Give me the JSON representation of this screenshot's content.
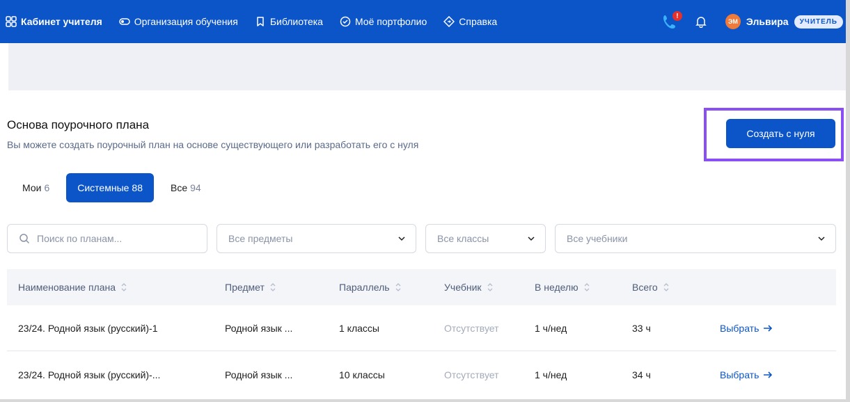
{
  "topbar": {
    "brand": "Кабинет учителя",
    "nav": [
      {
        "label": "Организация обучения",
        "icon": "toggle-icon"
      },
      {
        "label": "Библиотека",
        "icon": "bookmark-icon"
      },
      {
        "label": "Моё портфолио",
        "icon": "check-circle-icon"
      },
      {
        "label": "Справка",
        "icon": "diamond-arrow-icon"
      }
    ],
    "phone_badge": "!",
    "avatar_initials": "ЭМ",
    "username": "Эльвира",
    "role": "УЧИТЕЛЬ"
  },
  "header": {
    "title": "Основа поурочного плана",
    "subtitle": "Вы можете создать поурочный план на основе существующего или разработать его с нуля",
    "create_label": "Создать с нуля"
  },
  "tabs": [
    {
      "label": "Мои",
      "count": "6",
      "active": false
    },
    {
      "label": "Системные",
      "count": "88",
      "active": true
    },
    {
      "label": "Все",
      "count": "94",
      "active": false
    }
  ],
  "filters": {
    "search_placeholder": "Поиск по планам...",
    "subject": "Все предметы",
    "grade": "Все классы",
    "textbook": "Все учебники"
  },
  "table": {
    "columns": [
      "Наименование плана",
      "Предмет",
      "Параллель",
      "Учебник",
      "В неделю",
      "Всего"
    ],
    "rows": [
      {
        "name": "23/24. Родной язык (русский)-1",
        "subject": "Родной язык ...",
        "grade": "1 классы",
        "textbook": "Отсутствует",
        "per_week": "1 ч/нед",
        "total": "33 ч",
        "action": "Выбрать"
      },
      {
        "name": "23/24. Родной язык (русский)-...",
        "subject": "Родной язык ...",
        "grade": "10 классы",
        "textbook": "Отсутствует",
        "per_week": "1 ч/нед",
        "total": "34 ч",
        "action": "Выбрать"
      }
    ]
  },
  "colors": {
    "primary": "#0b55c8",
    "highlight": "#8a4ff2",
    "badge": "#e5302b"
  }
}
